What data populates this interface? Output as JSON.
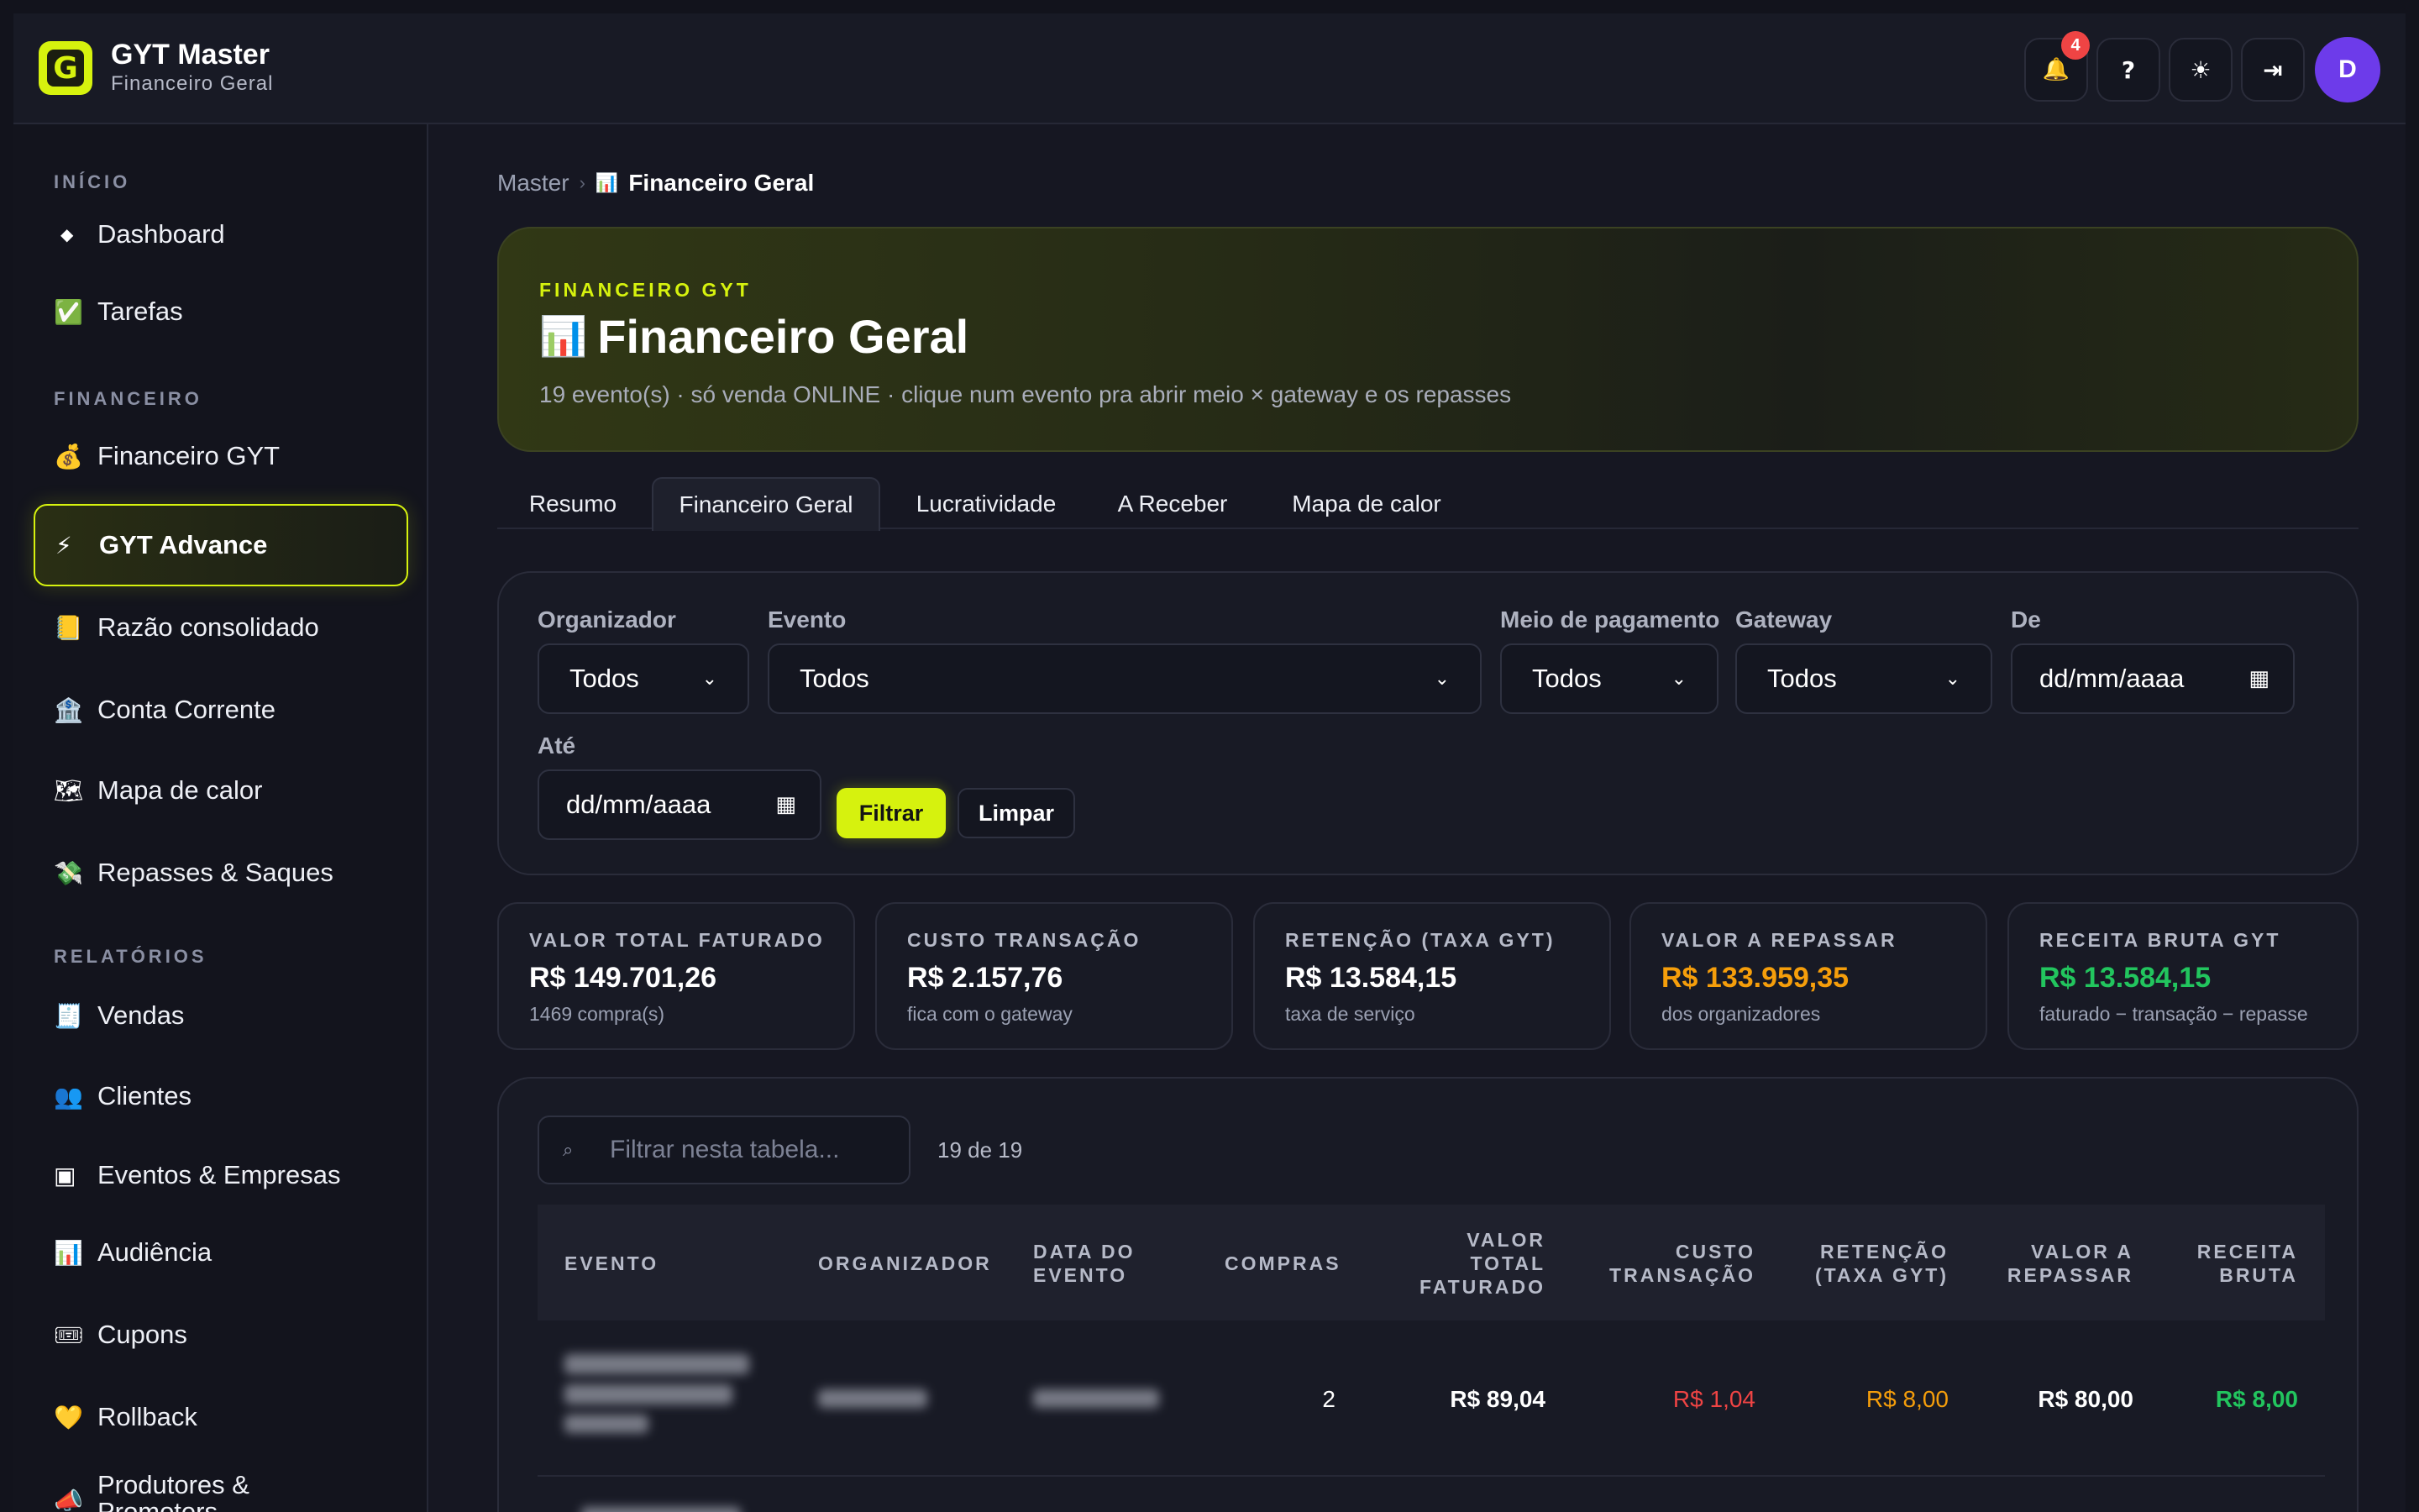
{
  "app": {
    "title": "GYT Master",
    "subtitle": "Financeiro Geral",
    "logo_letter": "G"
  },
  "header_actions": {
    "bell_icon": "🔔",
    "notifications": "4",
    "help": "?",
    "theme_icon": "☀",
    "logout_icon": "⇥",
    "avatar": "D"
  },
  "sidebar": {
    "sections": [
      "INÍCIO",
      "FINANCEIRO",
      "RELATÓRIOS"
    ],
    "items": [
      {
        "icon": "◆",
        "label": "Dashboard"
      },
      {
        "icon": "✅",
        "label": "Tarefas"
      },
      {
        "icon": "💰",
        "label": "Financeiro GYT"
      },
      {
        "icon": "⚡",
        "label": "GYT Advance"
      },
      {
        "icon": "📒",
        "label": "Razão consolidado"
      },
      {
        "icon": "🏦",
        "label": "Conta Corrente"
      },
      {
        "icon": "🗺",
        "label": "Mapa de calor"
      },
      {
        "icon": "💸",
        "label": "Repasses & Saques"
      },
      {
        "icon": "🧾",
        "label": "Vendas"
      },
      {
        "icon": "👥",
        "label": "Clientes"
      },
      {
        "icon": "▣",
        "label": "Eventos & Empresas"
      },
      {
        "icon": "📊",
        "label": "Audiência"
      },
      {
        "icon": "🎟",
        "label": "Cupons"
      },
      {
        "icon": "💛",
        "label": "Rollback"
      },
      {
        "icon": "📣",
        "label": "Produtores & Promoters"
      }
    ]
  },
  "breadcrumb": {
    "root": "Master",
    "sep": "›",
    "icon": "📊",
    "current": "Financeiro Geral"
  },
  "hero": {
    "kicker": "FINANCEIRO GYT",
    "icon": "📊",
    "title": "Financeiro Geral",
    "subtitle": "19 evento(s) · só venda ONLINE · clique num evento pra abrir meio × gateway e os repasses"
  },
  "tabs": [
    "Resumo",
    "Financeiro Geral",
    "Lucratividade",
    "A Receber",
    "Mapa de calor"
  ],
  "filters": {
    "organizador": {
      "label": "Organizador",
      "value": "Todos"
    },
    "evento": {
      "label": "Evento",
      "value": "Todos"
    },
    "meio": {
      "label": "Meio de pagamento",
      "value": "Todos"
    },
    "gateway": {
      "label": "Gateway",
      "value": "Todos"
    },
    "de": {
      "label": "De",
      "value": "dd/mm/aaaa"
    },
    "ate": {
      "label": "Até",
      "value": "dd/mm/aaaa"
    },
    "filtrar": "Filtrar",
    "limpar": "Limpar"
  },
  "kpis": [
    {
      "label": "VALOR TOTAL FATURADO",
      "value": "R$ 149.701,26",
      "sub": "1469 compra(s)",
      "color": "#ffffff"
    },
    {
      "label": "CUSTO TRANSAÇÃO",
      "value": "R$ 2.157,76",
      "sub": "fica com o gateway",
      "color": "#ffffff"
    },
    {
      "label": "RETENÇÃO (TAXA GYT)",
      "value": "R$ 13.584,15",
      "sub": "taxa de serviço",
      "color": "#ffffff"
    },
    {
      "label": "VALOR A REPASSAR",
      "value": "R$ 133.959,35",
      "sub": "dos organizadores",
      "color": "#f59e0b"
    },
    {
      "label": "RECEITA BRUTA GYT",
      "value": "R$ 13.584,15",
      "sub": "faturado − transação − repasse",
      "color": "#22c55e"
    }
  ],
  "table": {
    "search_placeholder": "Filtrar nesta tabela...",
    "count": "19 de 19",
    "columns": [
      "EVENTO",
      "ORGANIZADOR",
      "DATA DO EVENTO",
      "COMPRAS",
      "VALOR TOTAL FATURADO",
      "CUSTO TRANSAÇÃO",
      "RETENÇÃO (TAXA GYT)",
      "VALOR A REPASSAR",
      "RECEITA BRUTA"
    ],
    "rows": [
      {
        "compras": "2",
        "faturado": "R$ 89,04",
        "custo": "R$ 1,04",
        "retencao": "R$ 8,00",
        "repassar": "R$ 80,00",
        "receita": "R$ 8,00"
      }
    ]
  },
  "colors": {
    "accent": "#d6f20e",
    "red": "#ef4444",
    "orange": "#f59e0b",
    "green": "#22c55e",
    "purple": "#6d3bea"
  }
}
